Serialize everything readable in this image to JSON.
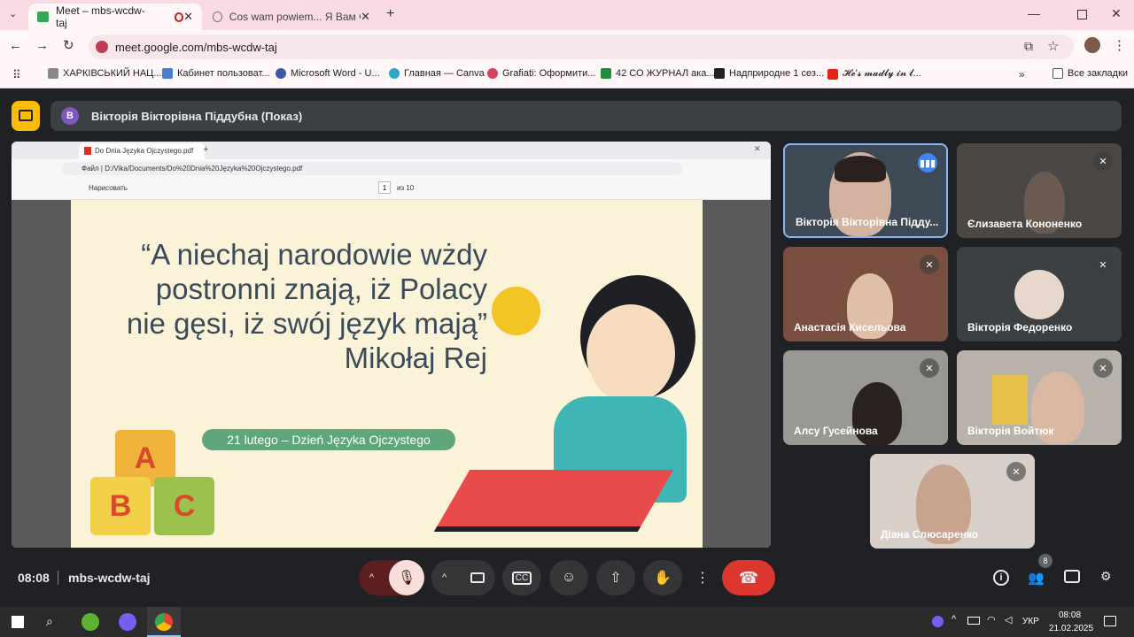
{
  "browser": {
    "tabs": [
      {
        "title": "Meet – mbs-wcdw-taj",
        "active": true
      },
      {
        "title": "Cos wam powiem... Я Вам что-",
        "active": false
      }
    ],
    "url": "meet.google.com/mbs-wcdw-taj",
    "bookmarks": [
      "ХАРКІВСЬКИЙ НАЦ...",
      "Кабинет пользоват...",
      "Microsoft Word - U...",
      "Главная — Canva",
      "Grafiati: Оформити...",
      "42 СО ЖУРНАЛ ака...",
      "Надприродне 1 сез...",
      "𝓗𝓮'𝓼 𝓶𝓪𝓭𝓵𝔂 𝓲𝓷 𝓵...",
      "Все закладки"
    ]
  },
  "meet": {
    "presenter": "Вікторія Вікторівна Піддубна (Показ)",
    "presenter_initial": "В",
    "time": "08:08",
    "code": "mbs-wcdw-taj",
    "people_count": "8",
    "participants": [
      {
        "name": "Вікторія Вікторівна Підду...",
        "speaking": true
      },
      {
        "name": "Єлизавета Кононенко",
        "muted": true
      },
      {
        "name": "Анастасія Кисельова",
        "muted": true
      },
      {
        "name": "Вікторія Федоренко",
        "muted": true
      },
      {
        "name": "Алсу Гусейнова",
        "muted": true
      },
      {
        "name": "Вікторія Войтюк",
        "muted": true
      },
      {
        "name": "Діана Слюсаренко",
        "muted": true
      }
    ]
  },
  "pdf": {
    "tab_title": "Do Dnia Języka Ojczystego.pdf",
    "file_label": "Файл",
    "path": "D:/Vika/Documents/Do%20Dnia%20Języka%20Ojczystego.pdf",
    "draw_label": "Нарисовать",
    "page": "1",
    "of": "из 10",
    "quote_lines": [
      "“A niechaj narodowie wżdy",
      "postronni znają, iż Polacy",
      "nie gęsi, iż swój język mają”"
    ],
    "author": "Mikołaj Rej",
    "banner": "21 lutego – Dzień Języka Ojczystego",
    "blocks": [
      "A",
      "B",
      "C"
    ]
  },
  "taskbar": {
    "lang": "УКР",
    "time": "08:08",
    "date": "21.02.2025"
  }
}
